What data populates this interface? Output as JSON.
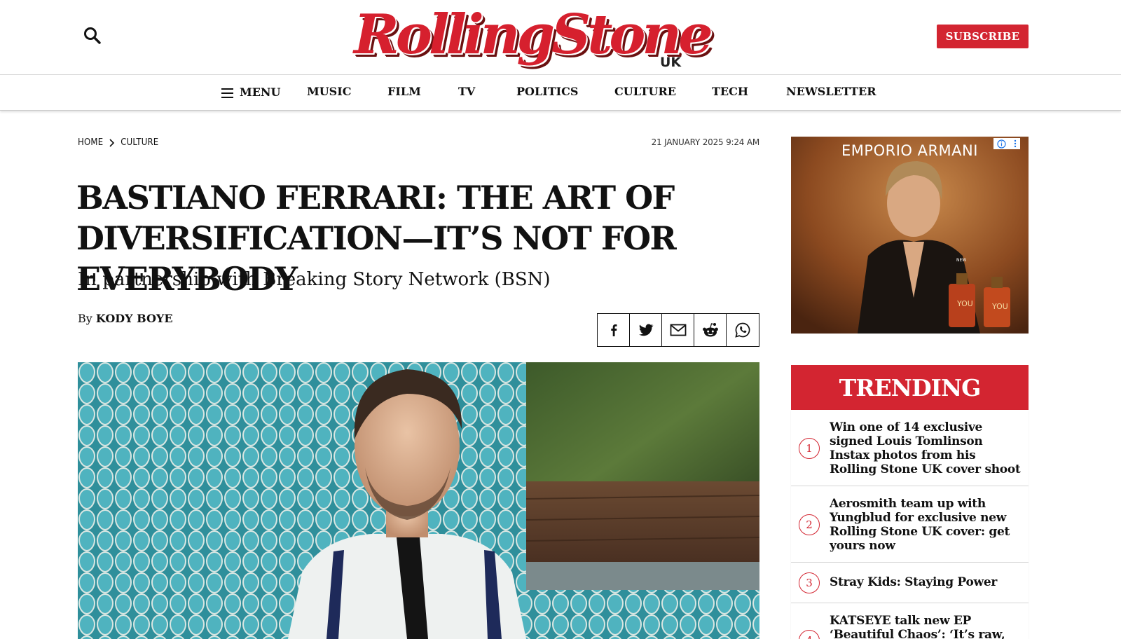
{
  "header": {
    "logo_text": "RollingStone",
    "logo_region": "UK",
    "subscribe_label": "SUBSCRIBE",
    "search_icon": "search-icon"
  },
  "nav": {
    "menu_label": "MENU",
    "items": [
      "MUSIC",
      "FILM",
      "TV",
      "POLITICS",
      "CULTURE",
      "TECH",
      "NEWSLETTER"
    ]
  },
  "breadcrumb": {
    "home": "HOME",
    "section": "CULTURE"
  },
  "article": {
    "date": "21 JANUARY 2025 9:24 AM",
    "headline": "BASTIANO FERRARI: THE ART OF DIVERSIFICATION—IT’S NOT FOR EVERYBODY",
    "subhead": "In partnership with Breaking Story Network (BSN)",
    "byline_prefix": "By",
    "author": "KODY BOYE"
  },
  "share": {
    "icons": [
      "facebook-icon",
      "twitter-icon",
      "email-icon",
      "reddit-icon",
      "whatsapp-icon"
    ]
  },
  "ad": {
    "brand": "EMPORIO ARMANI",
    "bottle_label": "YOU",
    "new_label": "NEW"
  },
  "trending": {
    "title": "TRENDING",
    "items": [
      {
        "num": "1",
        "title": "Win one of 14 exclusive signed Louis Tomlinson Instax photos from his Rolling Stone UK cover shoot"
      },
      {
        "num": "2",
        "title": "Aerosmith team up with Yungblud for exclusive new Rolling Stone UK cover: get yours now"
      },
      {
        "num": "3",
        "title": "Stray Kids: Staying Power"
      },
      {
        "num": "4",
        "title": "KATSEYE talk new EP ‘Beautiful Chaos’: ‘It’s raw,"
      }
    ]
  },
  "colors": {
    "brand_red": "#d32531",
    "text": "#111111"
  }
}
